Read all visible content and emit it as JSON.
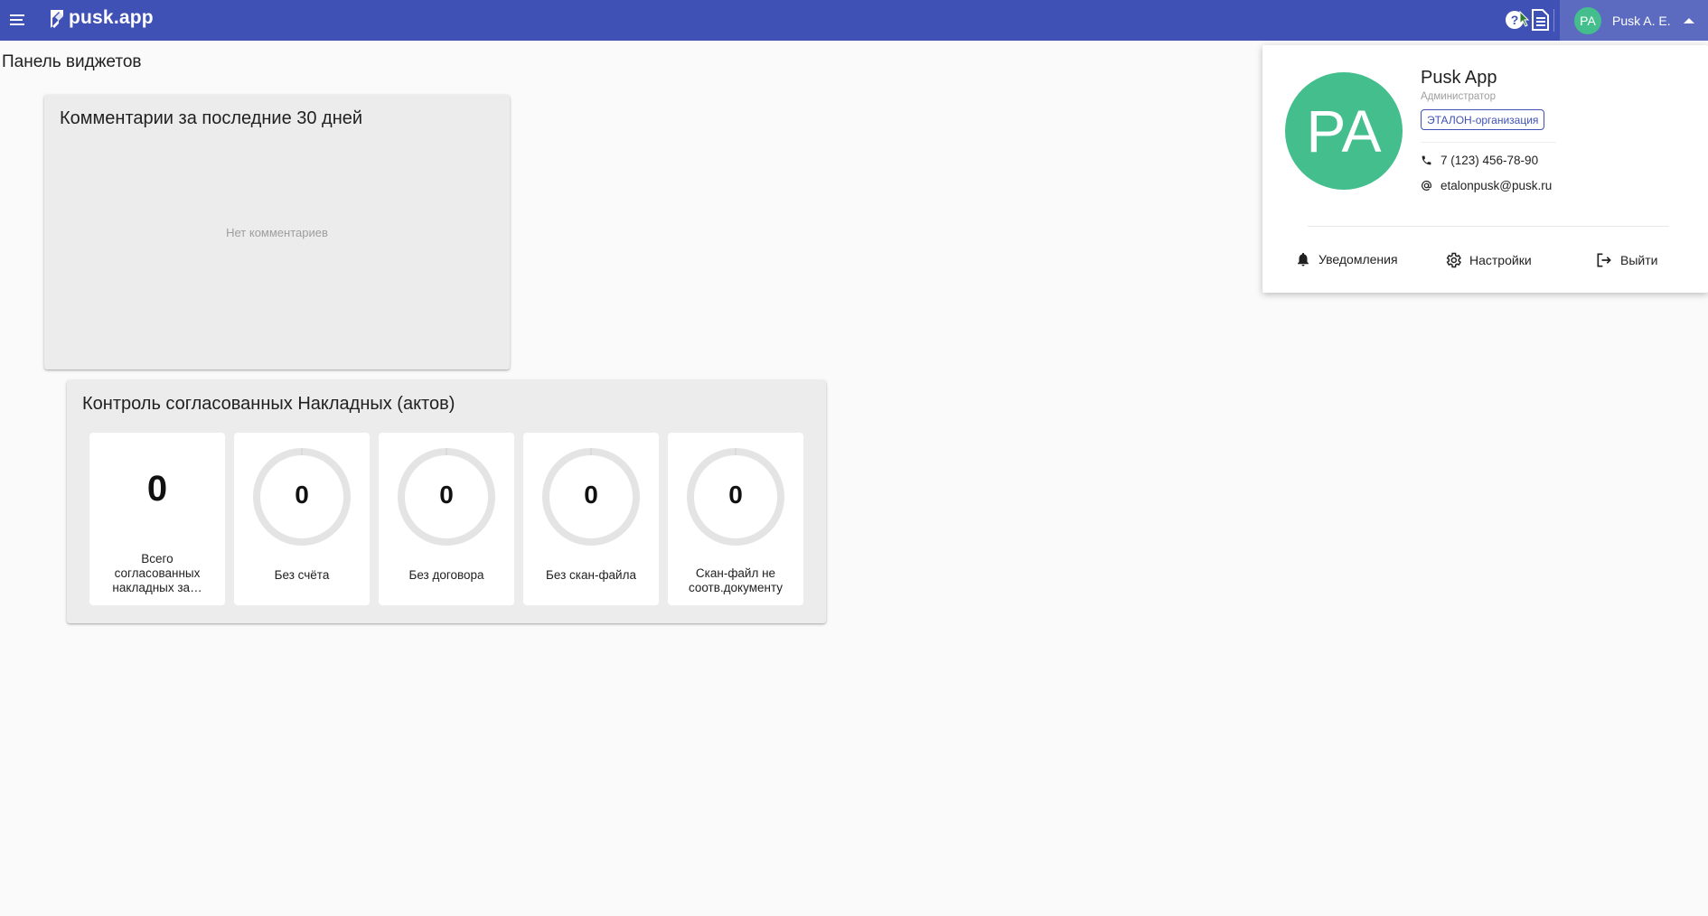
{
  "topbar": {
    "logo_text": "pusk.app",
    "user_chip": {
      "initials": "PA",
      "name": "Pusk A. E."
    }
  },
  "page": {
    "title": "Панель виджетов"
  },
  "widgets": {
    "comments": {
      "title": "Комментарии за последние 30 дней",
      "empty_text": "Нет комментариев"
    },
    "control": {
      "title": "Контроль согласованных Накладных (актов)",
      "tiles": [
        {
          "value": "0",
          "label": "Всего согласованных накладных за…"
        },
        {
          "value": "0",
          "label": "Без счёта"
        },
        {
          "value": "0",
          "label": "Без договора"
        },
        {
          "value": "0",
          "label": "Без скан-файла"
        },
        {
          "value": "0",
          "label": "Скан-файл не соотв.документу"
        }
      ]
    }
  },
  "profile": {
    "initials": "PA",
    "name": "Pusk App",
    "role": "Администратор",
    "organization": "ЭТАЛОН-организация",
    "phone": "7 (123) 456-78-90",
    "email": "etalonpusk@pusk.ru",
    "actions": {
      "notifications": "Уведомления",
      "settings": "Настройки",
      "logout": "Выйти"
    }
  },
  "colors": {
    "primary": "#3f51b5",
    "chip_bg": "#5c6bc0",
    "avatar": "#43be8c",
    "card_bg": "#ececec",
    "page_bg": "#fafafa"
  },
  "icons": [
    "menu-icon",
    "logo-icon",
    "help-icon",
    "document-icon",
    "phone-icon",
    "at-icon",
    "bell-icon",
    "gear-icon",
    "logout-icon"
  ]
}
